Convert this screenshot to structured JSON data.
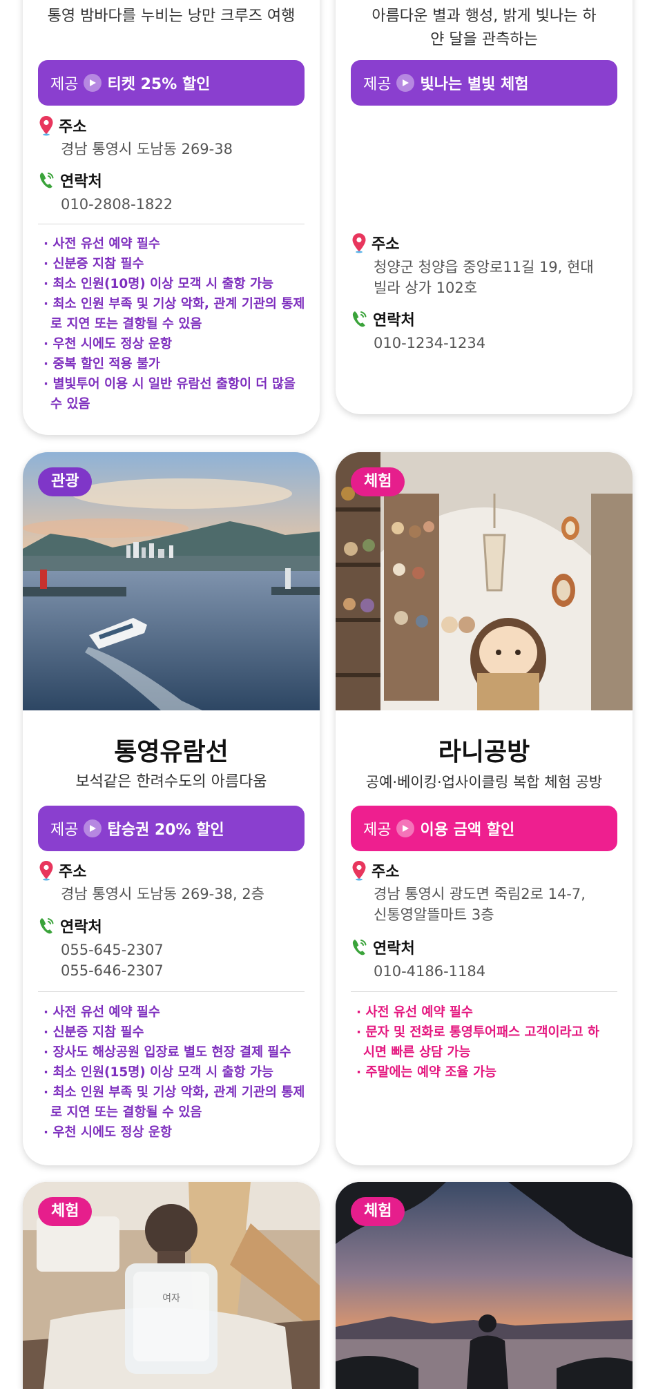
{
  "cards": [
    {
      "subtitle": "통영 밤바다를 누비는 낭만 크루즈 여행",
      "offer_label": "제공",
      "offer_text": "티켓 25% 할인",
      "address_label": "주소",
      "address": "경남 통영시 도남동 269-38",
      "contact_label": "연락처",
      "phone": "010-2808-1822",
      "notes": [
        "· 사전 유선 예약 필수",
        "· 신분증 지참 필수",
        "· 최소 인원(10명) 이상 모객 시 출항 가능",
        "· 최소 인원 부족 및 기상 악화, 관계 기관의 통제로 지연 또는 결항될 수 있음",
        "· 우천 시에도 정상 운항",
        "· 중복 할인 적용 불가",
        "· 별빛투어 이용 시 일반 유람선 출항이 더 많을 수 있음"
      ]
    },
    {
      "subtitle": "아름다운 별과 행성, 밝게 빛나는 하얀 달을 관측하는",
      "offer_label": "제공",
      "offer_text": "빛나는 별빛 체험",
      "address_label": "주소",
      "address": "청양군 청양읍 중앙로11길 19, 현대빌라 상가 102호",
      "contact_label": "연락처",
      "phone": "010-1234-1234"
    },
    {
      "badge": "관광",
      "title": "통영유람선",
      "subtitle": "보석같은 한려수도의 아름다움",
      "offer_label": "제공",
      "offer_text": "탑승권 20% 할인",
      "address_label": "주소",
      "address": "경남 통영시 도남동 269-38, 2층",
      "contact_label": "연락처",
      "phone1": "055-645-2307",
      "phone2": "055-646-2307",
      "notes": [
        "· 사전 유선 예약 필수",
        "· 신분증 지참 필수",
        "· 장사도 해상공원 입장료 별도 현장 결제 필수",
        "· 최소 인원(15명) 이상 모객 시 출항 가능",
        "· 최소 인원 부족 및 기상 악화, 관계 기관의 통제로 지연 또는 결항될 수 있음",
        "· 우천 시에도 정상 운항"
      ]
    },
    {
      "badge": "체험",
      "title": "라니공방",
      "subtitle": "공예·베이킹·업사이클링 복합 체험 공방",
      "offer_label": "제공",
      "offer_text": "이용 금액 할인",
      "address_label": "주소",
      "address": "경남 통영시 광도면 죽림2로 14-7, 신통영알뜰마트 3층",
      "contact_label": "연락처",
      "phone": "010-4186-1184",
      "notes": [
        "· 사전 유선 예약 필수",
        "· 문자 및 전화로 통영투어패스 고객이라고 하시면 빠른 상담 가능",
        "· 주말에는 예약 조율 가능"
      ]
    },
    {
      "badge": "체험",
      "bottle_label": "여자"
    },
    {
      "badge": "체험"
    }
  ],
  "colors": {
    "purple": "#8a3fcf",
    "pink": "#ee1f8f",
    "pin": "#e8365d",
    "phone": "#3aa33a"
  },
  "icons": [
    "location-pin-icon",
    "phone-icon",
    "chevron-right-icon"
  ]
}
